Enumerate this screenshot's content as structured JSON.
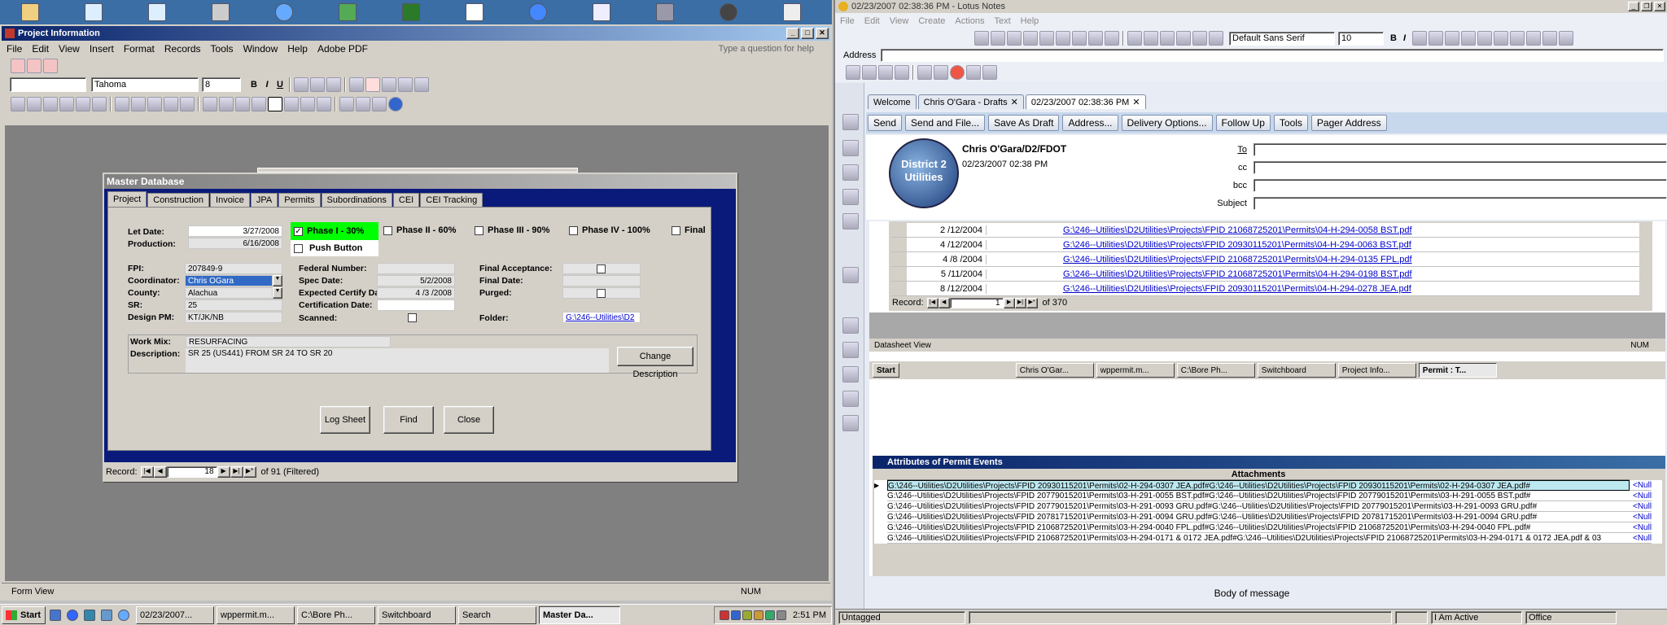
{
  "desktop_icons": [
    "xml-icon",
    "excel-icon"
  ],
  "access": {
    "title": "Project Information",
    "menus": [
      "File",
      "Edit",
      "View",
      "Insert",
      "Format",
      "Records",
      "Tools",
      "Window",
      "Help",
      "Adobe PDF"
    ],
    "help_placeholder": "Type a question for help",
    "font_name": "Tahoma",
    "font_size": "8",
    "status": "Form View",
    "status_right": "NUM"
  },
  "form": {
    "title": "Master Database",
    "tabs": [
      "Project",
      "Construction",
      "Invoice",
      "JPA",
      "Permits",
      "Subordinations",
      "CEI",
      "CEI Tracking"
    ],
    "let_date_label": "Let Date:",
    "let_date": "3/27/2008",
    "production_label": "Production:",
    "production": "6/16/2008",
    "phase1": "Phase I - 30%",
    "phase2": "Phase II - 60%",
    "phase3": "Phase III - 90%",
    "phase4": "Phase IV - 100%",
    "final": "Final",
    "push_button": "Push Button",
    "fpi_label": "FPI:",
    "fpi": "207849-9",
    "coordinator_label": "Coordinator:",
    "coordinator": "Chris OGara",
    "county_label": "County:",
    "county": "Alachua",
    "sr_label": "SR:",
    "sr": "25",
    "design_pm_label": "Design PM:",
    "design_pm": "KT/JK/NB",
    "federal_label": "Federal Number:",
    "spec_label": "Spec Date:",
    "spec": "5/2/2008",
    "ecd_label": "Expected Certify Date:",
    "ecd": "4 /3 /2008",
    "cert_label": "Certification Date:",
    "scanned_label": "Scanned:",
    "final_acc_label": "Final Acceptance:",
    "final_date_label": "Final Date:",
    "purged_label": "Purged:",
    "folder_label": "Folder:",
    "folder": "G:\\246--Utilities\\D2",
    "workmix_label": "Work Mix:",
    "workmix": "RESURFACING",
    "desc_label": "Description:",
    "desc": "SR 25 (US441) FROM SR 24 TO SR 20",
    "change_desc": "Change Description",
    "log_sheet": "Log Sheet",
    "find": "Find",
    "close": "Close",
    "record_label": "Record:",
    "record_num": "18",
    "record_of": "of 91 (Filtered)"
  },
  "taskbar_left": {
    "start": "Start",
    "items": [
      "02/23/2007...",
      "wppermit.m...",
      "C:\\Bore Ph...",
      "Switchboard",
      "Search",
      "Master Da..."
    ],
    "clock": "2:51 PM"
  },
  "notes": {
    "title": "02/23/2007 02:38:36 PM - Lotus Notes",
    "menus": [
      "File",
      "Edit",
      "View",
      "Create",
      "Actions",
      "Text",
      "Help"
    ],
    "font": "Default Sans Serif",
    "size": "10",
    "address_label": "Address",
    "tabs": [
      "Welcome",
      "Chris O'Gara - Drafts",
      "02/23/2007 02:38:36 PM"
    ],
    "actions": [
      "Send",
      "Send and File...",
      "Save As Draft",
      "Address...",
      "Delivery Options...",
      "Follow Up",
      "Tools",
      "Pager Address"
    ],
    "from": "Chris O'Gara/D2/FDOT",
    "date": "02/23/2007 02:38 PM",
    "logo_text": "District 2 Utilities",
    "to": "To",
    "cc": "cc",
    "bcc": "bcc",
    "subject": "Subject",
    "body_label": "Body of message",
    "status_untagged": "Untagged",
    "status_active": "I Am Active",
    "status_office": "Office"
  },
  "embedded": {
    "rows": [
      {
        "date": "2 /12/2004",
        "link": "G:\\246--Utilities\\D2Utilities\\Projects\\FPID 21068725201\\Permits\\04-H-294-0058 BST.pdf"
      },
      {
        "date": "4 /12/2004",
        "link": "G:\\246--Utilities\\D2Utilities\\Projects\\FPID 20930115201\\Permits\\04-H-294-0063 BST.pdf"
      },
      {
        "date": "4 /8 /2004",
        "link": "G:\\246--Utilities\\D2Utilities\\Projects\\FPID 21068725201\\Permits\\04-H-294-0135 FPL.pdf"
      },
      {
        "date": "5 /11/2004",
        "link": "G:\\246--Utilities\\D2Utilities\\Projects\\FPID 21068725201\\Permits\\04-H-294-0198 BST.pdf"
      },
      {
        "date": "8 /12/2004",
        "link": "G:\\246--Utilities\\D2Utilities\\Projects\\FPID 20930115201\\Permits\\04-H-294-0278 JEA.pdf"
      }
    ],
    "record_label": "Record:",
    "record_num": "1",
    "record_of": "of 370",
    "status": "Datasheet View",
    "status_right": "NUM",
    "taskbar": {
      "start": "Start",
      "items": [
        "Chris O'Gar...",
        "wppermit.m...",
        "C:\\Bore Ph...",
        "Switchboard",
        "Project Info...",
        "Permit : T..."
      ]
    },
    "attr_title": "Attributes of Permit Events",
    "attr_col": "Attachments",
    "attr_rows": [
      "G:\\246--Utilities\\D2Utilities\\Projects\\FPID 20930115201\\Permits\\02-H-294-0307 JEA.pdf#G:\\246--Utilities\\D2Utilities\\Projects\\FPID 20930115201\\Permits\\02-H-294-0307 JEA.pdf#",
      "G:\\246--Utilities\\D2Utilities\\Projects\\FPID 20779015201\\Permits\\03-H-291-0055 BST.pdf#G:\\246--Utilities\\D2Utilities\\Projects\\FPID 20779015201\\Permits\\03-H-291-0055 BST.pdf#",
      "G:\\246--Utilities\\D2Utilities\\Projects\\FPID 20779015201\\Permits\\03-H-291-0093 GRU.pdf#G:\\246--Utilities\\D2Utilities\\Projects\\FPID 20779015201\\Permits\\03-H-291-0093 GRU.pdf#",
      "G:\\246--Utilities\\D2Utilities\\Projects\\FPID 20781715201\\Permits\\03-H-291-0094 GRU.pdf#G:\\246--Utilities\\D2Utilities\\Projects\\FPID 20781715201\\Permits\\03-H-291-0094 GRU.pdf#",
      "G:\\246--Utilities\\D2Utilities\\Projects\\FPID 21068725201\\Permits\\03-H-294-0040 FPL.pdf#G:\\246--Utilities\\D2Utilities\\Projects\\FPID 21068725201\\Permits\\03-H-294-0040 FPL.pdf#",
      "G:\\246--Utilities\\D2Utilities\\Projects\\FPID 21068725201\\Permits\\03-H-294-0171 & 0172 JEA.pdf#G:\\246--Utilities\\D2Utilities\\Projects\\FPID 21068725201\\Permits\\03-H-294-0171 & 0172 JEA.pdf & 03"
    ],
    "null_label": "<Null"
  }
}
